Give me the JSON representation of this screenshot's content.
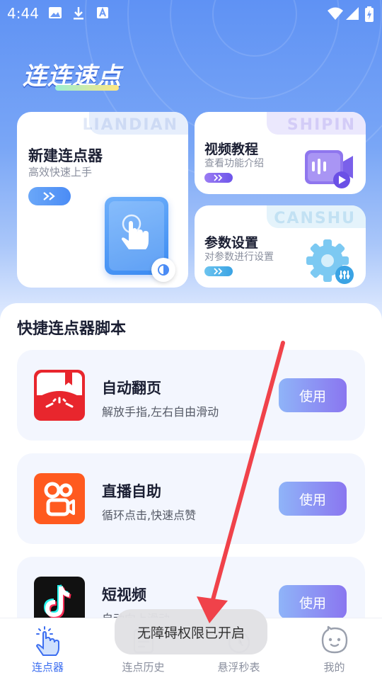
{
  "status_bar": {
    "time": "4:44"
  },
  "app": {
    "title": "连连速点"
  },
  "hero_cards": {
    "new_clicker": {
      "title": "新建连点器",
      "subtitle": "高效快速上手",
      "watermark": "LIANDIAN"
    },
    "video_tutorial": {
      "title": "视频教程",
      "subtitle": "查看功能介绍",
      "watermark": "SHIPIN"
    },
    "settings": {
      "title": "参数设置",
      "subtitle": "对参数进行设置",
      "watermark": "CANSHU"
    }
  },
  "scripts": {
    "section_title": "快捷连点器脚本",
    "items": [
      {
        "name": "自动翻页",
        "desc": "解放手指,左右自由滑动",
        "button": "使用",
        "icon": "book-icon"
      },
      {
        "name": "直播自助",
        "desc": "循环点击,快速点赞",
        "button": "使用",
        "icon": "kuaishou-icon"
      },
      {
        "name": "短视频",
        "desc": "自动向上滑动",
        "button": "使用",
        "icon": "tiktok-icon"
      }
    ]
  },
  "toast": "无障碍权限已开启",
  "nav": {
    "items": [
      {
        "label": "连点器",
        "icon": "tap-hand-icon",
        "active": true
      },
      {
        "label": "连点历史",
        "icon": "history-icon",
        "active": false
      },
      {
        "label": "悬浮秒表",
        "icon": "stopwatch-icon",
        "active": false
      },
      {
        "label": "我的",
        "icon": "face-icon",
        "active": false
      }
    ]
  },
  "colors": {
    "accent": "#3c6ef0",
    "hero_top": "#5f92f4",
    "use_button_start": "#8fb4f8",
    "use_button_end": "#8a76f0",
    "arrow": "#f0424a"
  }
}
